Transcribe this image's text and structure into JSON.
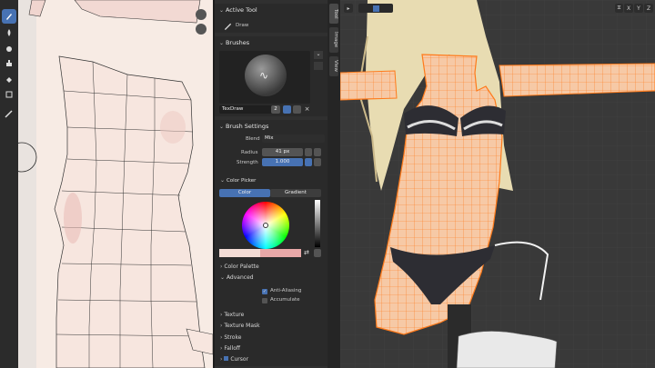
{
  "active_tool": {
    "header": "Active Tool",
    "tool_label": "Draw"
  },
  "brushes": {
    "header": "Brushes",
    "brush_name": "TexDraw",
    "user_count": "2"
  },
  "brush_settings": {
    "header": "Brush Settings",
    "blend_label": "Blend",
    "blend_value": "Mix",
    "radius_label": "Radius",
    "radius_value": "41 px",
    "strength_label": "Strength",
    "strength_value": "1.000"
  },
  "color_picker": {
    "header": "Color Picker",
    "tab_color": "Color",
    "tab_gradient": "Gradient"
  },
  "color_palette": {
    "header": "Color Palette"
  },
  "advanced": {
    "header": "Advanced",
    "anti_aliasing": "Anti-Aliasing",
    "accumulate": "Accumulate"
  },
  "subpanels": {
    "texture": "Texture",
    "texture_mask": "Texture Mask",
    "stroke": "Stroke",
    "falloff": "Falloff",
    "cursor": "Cursor"
  },
  "tabs": {
    "tool": "Tool",
    "image": "Image",
    "view": "View"
  },
  "viewport": {
    "axis_x": "X",
    "axis_y": "Y",
    "axis_z": "Z"
  },
  "colors": {
    "accent": "#4772b3",
    "mesh_wire": "#ff7a1a",
    "brush_color": "#f3dcd5"
  }
}
